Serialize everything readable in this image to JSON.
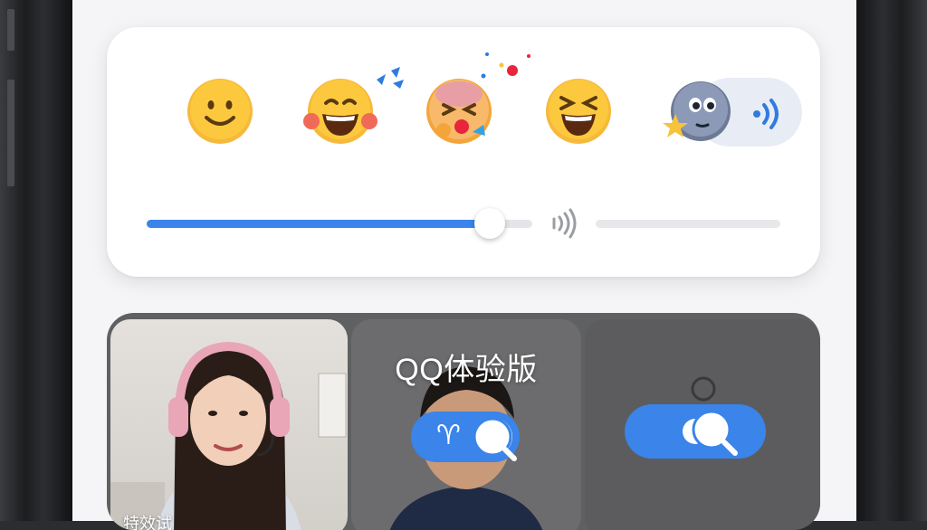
{
  "emoji_panel": {
    "emojis": [
      {
        "name": "slightly-smiling-face"
      },
      {
        "name": "blushing-laughing-face"
      },
      {
        "name": "party-blowing-face"
      },
      {
        "name": "grinning-squinting-face"
      },
      {
        "name": "star-moon-face"
      }
    ],
    "volume_level": 0.89,
    "voice_icon": "sound-wave-icon"
  },
  "video_call": {
    "title": "QQ体验版",
    "tiles": [
      {
        "label": "特效试",
        "kind": "woman-headset"
      },
      {
        "label": "",
        "kind": "man"
      },
      {
        "label": "",
        "kind": "empty"
      }
    ],
    "toggle_symbol": "♈︎",
    "accent_color": "#3a84ea"
  }
}
